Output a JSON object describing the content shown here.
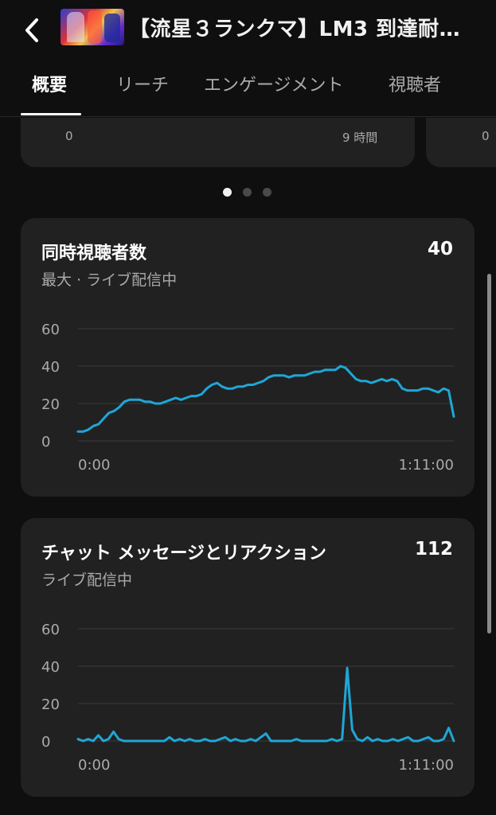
{
  "header": {
    "back_icon": "chevron-left-icon",
    "title": "【流星３ランクマ】LM3 到達耐…"
  },
  "tabs": [
    {
      "label": "概要",
      "active": true
    },
    {
      "label": "リーチ",
      "active": false
    },
    {
      "label": "エンゲージメント",
      "active": false
    },
    {
      "label": "視聴者",
      "active": false
    }
  ],
  "top_cards": {
    "left": {
      "top_label": "0",
      "axis_start": "0",
      "axis_end": "9 時間"
    },
    "right": {
      "top_label": "0.0",
      "axis_start": "0"
    }
  },
  "carousel": {
    "count": 3,
    "active_index": 0
  },
  "concurrent": {
    "title": "同時視聴者数",
    "value": "40",
    "subtitle": "最大 · ライブ配信中",
    "chart_data": {
      "type": "line",
      "title": "同時視聴者数",
      "x_start_label": "0:00",
      "x_end_label": "1:11:00",
      "xlim": [
        0,
        71
      ],
      "ylim": [
        0,
        60
      ],
      "yticks": [
        0,
        20,
        40,
        60
      ],
      "grid": true,
      "color": "#1fa6d6",
      "values": [
        5,
        5,
        6,
        8,
        9,
        12,
        15,
        16,
        18,
        21,
        22,
        22,
        22,
        21,
        21,
        20,
        20,
        21,
        22,
        23,
        22,
        23,
        24,
        24,
        25,
        28,
        30,
        31,
        29,
        28,
        28,
        29,
        29,
        30,
        30,
        31,
        32,
        34,
        35,
        35,
        35,
        34,
        35,
        35,
        35,
        36,
        37,
        37,
        38,
        38,
        38,
        40,
        39,
        36,
        33,
        32,
        32,
        31,
        32,
        33,
        32,
        33,
        32,
        28,
        27,
        27,
        27,
        28,
        28,
        27,
        26,
        28,
        27,
        13
      ]
    }
  },
  "chat": {
    "title": "チャット メッセージとリアクション",
    "value": "112",
    "subtitle": "ライブ配信中",
    "chart_data": {
      "type": "line",
      "title": "チャット メッセージとリアクション",
      "x_start_label": "0:00",
      "x_end_label": "1:11:00",
      "xlim": [
        0,
        71
      ],
      "ylim": [
        0,
        60
      ],
      "yticks": [
        0,
        20,
        40,
        60
      ],
      "grid": true,
      "color": "#1fa6d6",
      "values": [
        1,
        0,
        1,
        0,
        3,
        0,
        1,
        5,
        1,
        0,
        0,
        0,
        0,
        0,
        0,
        0,
        0,
        0,
        2,
        0,
        1,
        0,
        1,
        0,
        0,
        1,
        0,
        0,
        1,
        2,
        0,
        1,
        0,
        0,
        1,
        0,
        2,
        4,
        0,
        0,
        0,
        0,
        0,
        1,
        0,
        0,
        0,
        0,
        0,
        0,
        1,
        0,
        1,
        39,
        6,
        1,
        0,
        2,
        0,
        1,
        0,
        0,
        1,
        0,
        1,
        2,
        0,
        0,
        1,
        2,
        0,
        0,
        1,
        7,
        0
      ]
    }
  },
  "colors": {
    "accent": "#1fa6d6",
    "card_bg": "#212121",
    "page_bg": "#0f0f0f"
  }
}
